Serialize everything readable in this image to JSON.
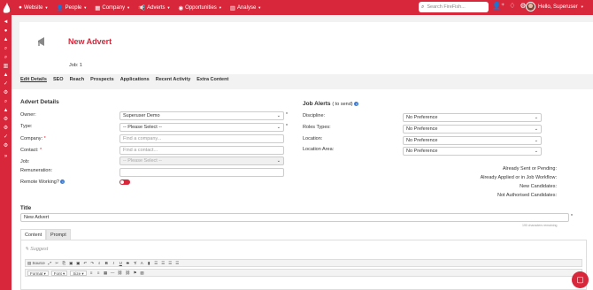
{
  "nav": {
    "items": [
      {
        "icon": "globe-icon",
        "glyph": "●",
        "label": "Website"
      },
      {
        "icon": "people-icon",
        "glyph": "👤",
        "label": "People"
      },
      {
        "icon": "company-icon",
        "glyph": "▦",
        "label": "Company"
      },
      {
        "icon": "megaphone-icon",
        "glyph": "📢",
        "label": "Adverts"
      },
      {
        "icon": "opportunities-icon",
        "glyph": "◉",
        "label": "Opportunities"
      },
      {
        "icon": "analyse-icon",
        "glyph": "▥",
        "label": "Analyse"
      }
    ],
    "search_placeholder": "Search FireFish...",
    "user_greeting": "Hello, Superuser"
  },
  "header": {
    "title": "New Advert",
    "job_label": "Job: 1"
  },
  "tabs": [
    "Edit Details",
    "SEO",
    "Reach",
    "Prospects",
    "Applications",
    "Recent Activity",
    "Extra Content"
  ],
  "advert_details": {
    "heading": "Advert Details",
    "owner_label": "Owner:",
    "owner_value": "Superuser Demo",
    "type_label": "Type:",
    "type_value": "-- Please Select --",
    "company_label": "Company:",
    "company_placeholder": "Find a company...",
    "contact_label": "Contact:",
    "contact_placeholder": "Find a contact...",
    "job_label": "Job:",
    "job_value": "-- Please Select --",
    "remuneration_label": "Remuneration:",
    "remote_label": "Remote Working?"
  },
  "job_alerts": {
    "heading": "Job Alerts",
    "badge": "( to send)",
    "discipline_label": "Discipline:",
    "discipline_value": "No Preference",
    "roles_label": "Roles Types:",
    "roles_value": "No Preference",
    "location_label": "Location:",
    "location_value": "No Preference",
    "location_area_label": "Location Area:",
    "location_area_value": "No Preference",
    "stats": [
      "Already Sent or Pending:",
      "Already Applied or in Job Workflow:",
      "New Candidates:",
      "Not Authorised Candidates:"
    ]
  },
  "title_section": {
    "label": "Title",
    "value": "New Advert",
    "char_count": "190 characters remaining"
  },
  "editor": {
    "tabs": [
      "Content",
      "Prompt"
    ],
    "suggest_label": "Suggest",
    "source_label": "Source",
    "format_label": "Format",
    "font_label": "Font",
    "size_label": "Size"
  },
  "colors": {
    "brand": "#d8263a"
  }
}
